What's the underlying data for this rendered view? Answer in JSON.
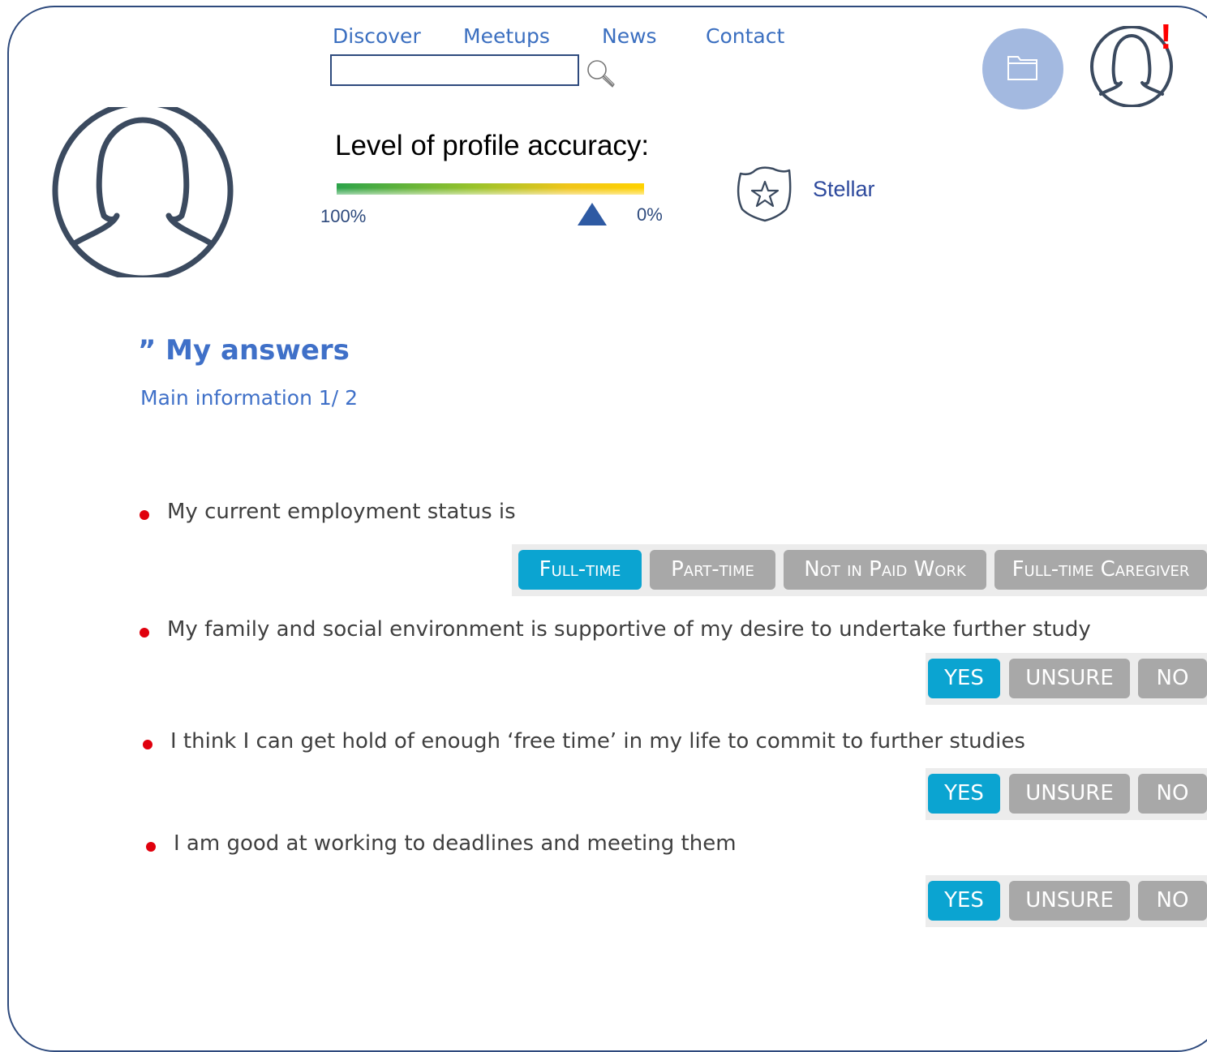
{
  "nav": {
    "items": [
      "Discover",
      "Meetups",
      "News",
      "Contact"
    ]
  },
  "search": {
    "value": "",
    "placeholder": ""
  },
  "header": {
    "alert_mark": "!"
  },
  "profile": {
    "accuracy_title": "Level of profile accuracy:",
    "accuracy_left_label": "100%",
    "accuracy_right_label": "0%",
    "accuracy_marker_fraction": 0.83,
    "badge_label": "Stellar"
  },
  "answers": {
    "title": "” My answers",
    "subtitle": "Main information 1/ 2",
    "questions": [
      {
        "text": "My current employment status is",
        "options": [
          "Full-time",
          "Part-time",
          "Not in Paid Work",
          "Full-time Caregiver"
        ],
        "selected": "Full-time"
      },
      {
        "text": "My family and social environment is supportive of my desire to undertake further study",
        "options": [
          "YES",
          "UNSURE",
          "NO"
        ],
        "selected": "YES"
      },
      {
        "text": "I think I can get hold of enough ‘free time’ in my life to commit to further studies",
        "options": [
          "YES",
          "UNSURE",
          "NO"
        ],
        "selected": "YES"
      },
      {
        "text": "I am good at working to deadlines and meeting them",
        "options": [
          "YES",
          "UNSURE",
          "NO"
        ],
        "selected": "YES"
      }
    ]
  },
  "colors": {
    "accent": "#3f70c8",
    "selected": "#0ba4d1",
    "unselected": "#a8a8a8",
    "bullet": "#e0000d",
    "frame": "#2e4a7d"
  },
  "icons": [
    "search-icon",
    "folder-icon",
    "user-icon",
    "avatar-icon",
    "star-badge-icon"
  ]
}
